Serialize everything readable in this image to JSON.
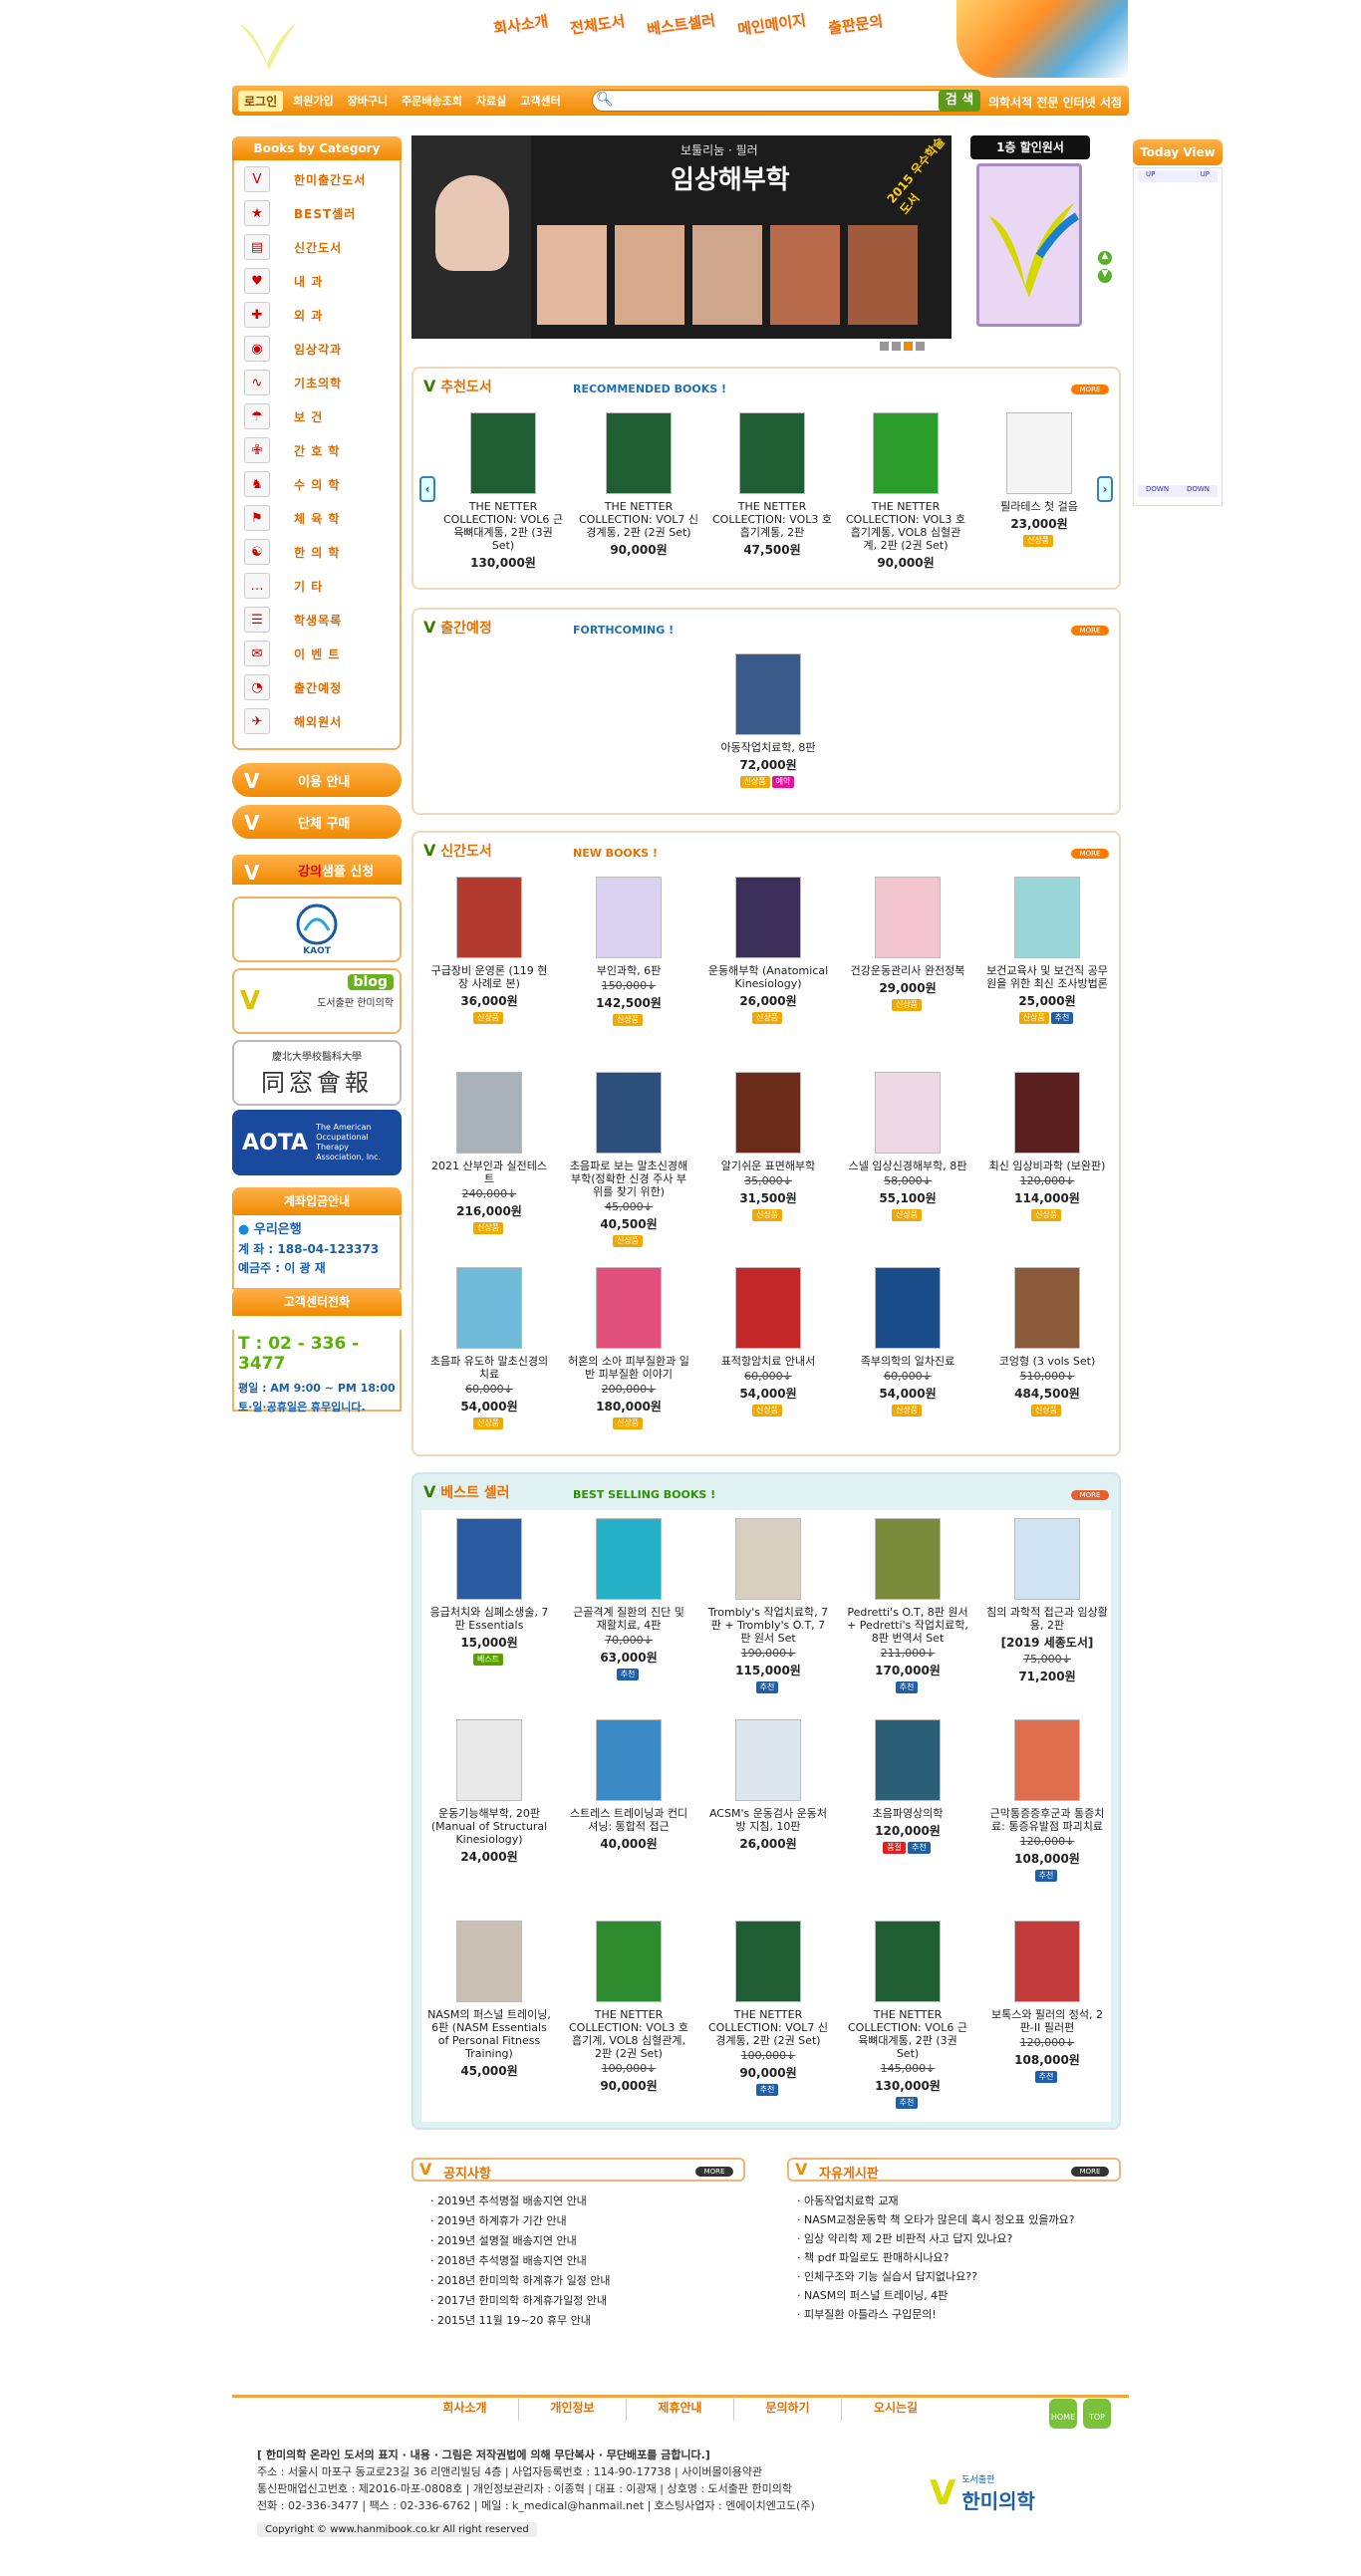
{
  "header": {
    "topnav": [
      "회사소개",
      "전체도서",
      "베스트셀러",
      "메인메이지",
      "출판문의"
    ],
    "menu": {
      "login": "로그인",
      "items": [
        "회원가입",
        "장바구니",
        "주문배송조회",
        "자료실",
        "고객센터"
      ],
      "search_button": "검 색",
      "shop_text": "의학서적 전문 인터넷 서점"
    }
  },
  "sidebar": {
    "category_title": "Books by Category",
    "categories": [
      "한미출간도서",
      "BEST셀러",
      "신간도서",
      "내  과",
      "외  과",
      "임상각과",
      "기초의학",
      "보  건",
      "간 호 학",
      "수 의 학",
      "체 육 학",
      "한 의 학",
      "기  타",
      "학생목록",
      "이 벤 트",
      "출간예정",
      "해외원서"
    ],
    "buttons": [
      "이용 안내",
      "단체 구매"
    ],
    "lecture": {
      "prefix": "강의",
      "suffix": " 샘플 신청"
    },
    "banners": [
      "KAOT",
      "blog",
      "도서출판 한미의학",
      "慶北大學校醫科大學",
      "同窓會報",
      "AOTA",
      "The American Occupational Therapy Association, Inc."
    ],
    "bank": {
      "title": "계좌입금안내",
      "bank": "우리은행",
      "account": "계    좌 : 188-04-123373",
      "holder": "예금주 : 이 광 재"
    },
    "cs": {
      "title": "고객센터전화",
      "phone": "T : 02 - 336 - 3477",
      "hours": "평일 : AM 9:00 ~ PM 18:00",
      "holiday": "토·일·공휴일은 휴무입니다."
    }
  },
  "slider": {
    "subtitle": "보툴리눔 · 필러",
    "title": "임상해부학",
    "badge": "2015 우수학술도서",
    "sale_title": "1층 할인원서"
  },
  "today": {
    "title": "Today View",
    "up": "UP",
    "down": "DOWN"
  },
  "recommended": {
    "title": "추천도서",
    "sub": "RECOMMENDED BOOKS !",
    "more": "MORE",
    "books": [
      {
        "title": "THE NETTER COLLECTION: VOL6 근육뼈대계통, 2판 (3권 Set)",
        "price": "130,000원"
      },
      {
        "title": "THE NETTER COLLECTION: VOL7 신경계통, 2판 (2권 Set)",
        "price": "90,000원"
      },
      {
        "title": "THE NETTER COLLECTION: VOL3 호흡기계통, 2판",
        "price": "47,500원"
      },
      {
        "title": "THE NETTER COLLECTION: VOL3 호흡기계통, VOL8 심혈관계, 2판 (2권 Set)",
        "price": "90,000원"
      },
      {
        "title": "필라테스 첫 걸음",
        "price": "23,000원",
        "tag": "신상품"
      }
    ]
  },
  "forthcoming": {
    "title": "출간예정",
    "sub": "FORTHCOMING !",
    "more": "MORE",
    "books": [
      {
        "title": "아동작업치료학, 8판",
        "price": "72,000원",
        "tags": [
          "신상품",
          "예약"
        ]
      }
    ]
  },
  "newbooks": {
    "title": "신간도서",
    "sub": "NEW BOOKS !",
    "more": "MORE",
    "books": [
      {
        "title": "구급장비 운영론 (119 현장 사례로 본)",
        "price": "36,000원",
        "tags": [
          "신상품"
        ]
      },
      {
        "title": "부인과학, 6판",
        "old": "150,000↓",
        "price": "142,500원",
        "tags": [
          "신상품"
        ]
      },
      {
        "title": "운동해부학 (Anatomical Kinesiology)",
        "price": "26,000원",
        "tags": [
          "신상품"
        ]
      },
      {
        "title": "건강운동관리사 완전정복",
        "price": "29,000원",
        "tags": [
          "신상품"
        ]
      },
      {
        "title": "보건교육사 및 보건직 공무원을 위한 최신 조사방법론",
        "price": "25,000원",
        "tags": [
          "신상품",
          "추천"
        ]
      },
      {
        "title": "2021 산부인과 실전테스트",
        "old": "240,000↓",
        "price": "216,000원",
        "tags": [
          "신상품"
        ]
      },
      {
        "title": "초음파로 보는 말초신경해부학(정확한 신경 주사 부위를 찾기 위한)",
        "old": "45,000↓",
        "price": "40,500원",
        "tags": [
          "신상품"
        ]
      },
      {
        "title": "알기쉬운 표면해부학",
        "old": "35,000↓",
        "price": "31,500원",
        "tags": [
          "신상품"
        ]
      },
      {
        "title": "스넬 임상신경해부학, 8판",
        "old": "58,000↓",
        "price": "55,100원",
        "tags": [
          "신상품"
        ]
      },
      {
        "title": "최신 임상비과학 (보완판)",
        "old": "120,000↓",
        "price": "114,000원",
        "tags": [
          "신상품"
        ]
      },
      {
        "title": "초음파 유도하 말초신경의 치료",
        "old": "60,000↓",
        "price": "54,000원",
        "tags": [
          "신상품"
        ]
      },
      {
        "title": "허혼의 소아 피부질환과 일반 피부질환 이야기",
        "old": "200,000↓",
        "price": "180,000원",
        "tags": [
          "신상품"
        ]
      },
      {
        "title": "표적항암치료 안내서",
        "old": "60,000↓",
        "price": "54,000원",
        "tags": [
          "신상품"
        ]
      },
      {
        "title": "족부의학의 일차진료",
        "old": "60,000↓",
        "price": "54,000원",
        "tags": [
          "신상품"
        ]
      },
      {
        "title": "코엉형 (3 vols Set)",
        "old": "510,000↓",
        "price": "484,500원",
        "tags": [
          "신상품"
        ]
      }
    ]
  },
  "bestsellers": {
    "title": "베스트 셀러",
    "sub": "BEST SELLING BOOKS !",
    "more": "MORE",
    "books": [
      {
        "title": "응급처치와 심폐소생술, 7판 Essentials",
        "price": "15,000원",
        "tags": [
          "베스트"
        ]
      },
      {
        "title": "근골격계 질환의 진단 및 재활치료, 4판",
        "old": "70,000↓",
        "price": "63,000원",
        "tags": [
          "추천"
        ]
      },
      {
        "title": "Trombly's 작업치료학, 7판 + Trombly's O.T, 7판 원서 Set",
        "old": "190,000↓",
        "price": "115,000원",
        "tags": [
          "추천"
        ]
      },
      {
        "title": "Pedretti's O.T, 8판 원서 + Pedretti's 작업치료학, 8판 번역서 Set",
        "old": "211,000↓",
        "price": "170,000원",
        "tags": [
          "추천"
        ]
      },
      {
        "title": "침의 과학적 접근과 임상활용, 2판",
        "note": "[2019 세종도서]",
        "old": "75,000↓",
        "price": "71,200원"
      },
      {
        "title": "운동기능해부학, 20판 (Manual of Structural Kinesiology)",
        "price": "24,000원"
      },
      {
        "title": "스트레스 트레이닝과 컨디셔닝: 통합적 접근",
        "price": "40,000원"
      },
      {
        "title": "ACSM's 운동검사 운동처방 지침, 10판",
        "price": "26,000원"
      },
      {
        "title": "초음파영상의학",
        "price": "120,000원",
        "tags": [
          "품절",
          "추천"
        ]
      },
      {
        "title": "근막통증증후군과 통증치료: 통증유발점 파괴치료",
        "old": "120,000↓",
        "price": "108,000원",
        "tags": [
          "추천"
        ]
      },
      {
        "title": "NASM의 퍼스널 트레이닝, 6판 (NASM Essentials of Personal Fitness Training)",
        "price": "45,000원"
      },
      {
        "title": "THE NETTER COLLECTION: VOL3 호흡기계, VOL8 심혈관계, 2판 (2권 Set)",
        "old": "100,000↓",
        "price": "90,000원"
      },
      {
        "title": "THE NETTER COLLECTION: VOL7 신경계통, 2판 (2권 Set)",
        "old": "100,000↓",
        "price": "90,000원",
        "tags": [
          "추천"
        ]
      },
      {
        "title": "THE NETTER COLLECTION: VOL6 근육뼈대계통, 2판 (3권 Set)",
        "old": "145,000↓",
        "price": "130,000원",
        "tags": [
          "추천"
        ]
      },
      {
        "title": "보톡스와 필러의 정석, 2판-II 필러편",
        "old": "120,000↓",
        "price": "108,000원",
        "tags": [
          "추천"
        ]
      }
    ]
  },
  "notice": {
    "title": "공지사항",
    "more": "MORE",
    "items": [
      "2019년 추석명절 배송지연 안내",
      "2019년 하계휴가 기간 안내",
      "2019년 설명절 배송지연 안내",
      "2018년 추석명절 배송지연 안내",
      "2018년 한미의학 하계휴가 일정 안내",
      "2017년 한미의학 하계휴가일정 안내",
      "2015년 11월 19~20 휴무 안내"
    ]
  },
  "qna": {
    "title": "자유게시판",
    "more": "MORE",
    "items": [
      "아동작업치료학 교재",
      "NASM교정운동학 책 오타가 많은데 혹시 정오표 있을까요?",
      "임상 약리학 제 2판 비판적 사고 답지 있나요?",
      "책 pdf 파일로도 판매하시나요?",
      "인체구조와 기능 실습서 답지없나요??",
      "NASM의 퍼스널 트레이닝, 4판",
      "피부질환 아틀라스 구입문의!"
    ]
  },
  "footer": {
    "nav": [
      "회사소개",
      "개인정보",
      "제휴안내",
      "문의하기",
      "오시는길"
    ],
    "home": "HOME",
    "top": "TOP",
    "notice_line": "[ 한미의학 온라인 도서의 표지 · 내용 · 그림은 저작권법에 의해 무단복사 · 무단배포를 금합니다.]",
    "address": "주소 : 서울시 마포구 동교로23길 36 리앤리빌딩 4층 | 사업자등록번호 : 114-90-17738 | 사이버몰이용약관",
    "license": "통신판매업신고번호 : 제2016-마포-0808호 | 개인정보관리자 : 이종혁 | 대표 : 이광재 | 상호명 : 도서출판 한미의학",
    "contact": "전화 : 02-336-3477 | 팩스 : 02-336-6762 | 메일 : k_medical@hanmail.net | 호스팅사업자 : 엔에이치엔고도(주)",
    "copyright": "Copyright © www.hanmibook.co.kr All right reserved",
    "logo_small": "도서출판",
    "logo_name": "한미의학"
  }
}
